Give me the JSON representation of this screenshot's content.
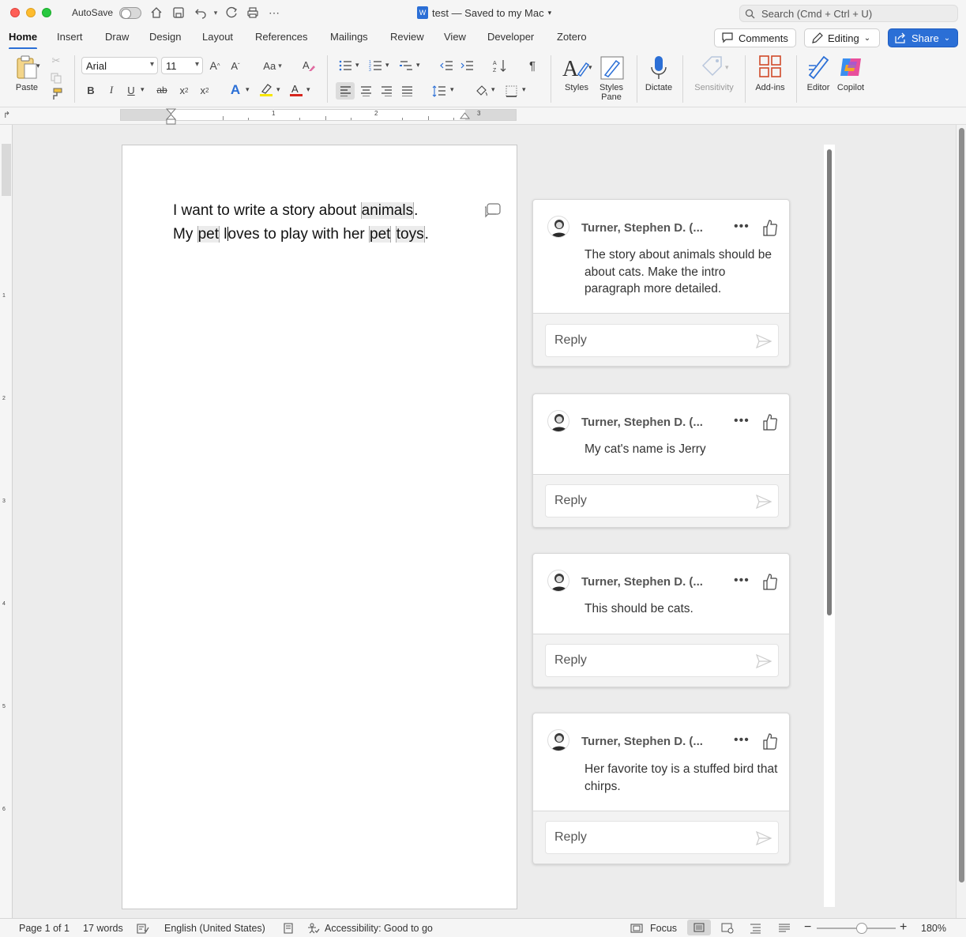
{
  "titlebar": {
    "autosave_label": "AutoSave",
    "doc_title": "test — Saved to my Mac",
    "search_placeholder": "Search (Cmd + Ctrl + U)"
  },
  "tabs": [
    "Home",
    "Insert",
    "Draw",
    "Design",
    "Layout",
    "References",
    "Mailings",
    "Review",
    "View",
    "Developer",
    "Zotero"
  ],
  "tab_actions": {
    "comments": "Comments",
    "editing": "Editing",
    "share": "Share"
  },
  "ribbon": {
    "paste_label": "Paste",
    "font_name": "Arial",
    "font_size": "11",
    "styles_label": "Styles",
    "styles_pane_label": "Styles Pane",
    "dictate_label": "Dictate",
    "sensitivity_label": "Sensitivity",
    "addins_label": "Add-ins",
    "editor_label": "Editor",
    "copilot_label": "Copilot",
    "change_case": "Aa",
    "bold": "B",
    "italic": "I",
    "underline": "U",
    "strike": "ab",
    "subscript": "x",
    "superscript": "x",
    "pilcrow": "¶"
  },
  "ruler": {
    "numbers": [
      "1",
      "2",
      "3"
    ]
  },
  "vruler": {
    "numbers": [
      "1",
      "2",
      "3",
      "4",
      "5",
      "6"
    ]
  },
  "document": {
    "line1": {
      "before": "I want to write a story about ",
      "hl": "animals",
      "after": "."
    },
    "line2": {
      "w1": "My ",
      "hl1": "pet",
      "mid1": " l",
      "mid2": "oves to play with her ",
      "hl2": "pet",
      "sp": " ",
      "hl3": "toys",
      "end": "."
    }
  },
  "comments": [
    {
      "author": "Turner, Stephen D. (...",
      "text": "The story about animals should be about cats. Make the intro paragraph more detailed.",
      "reply_placeholder": "Reply"
    },
    {
      "author": "Turner, Stephen D. (...",
      "text": "My cat's name is Jerry",
      "reply_placeholder": "Reply"
    },
    {
      "author": "Turner, Stephen D. (...",
      "text": "This should be cats.",
      "reply_placeholder": "Reply"
    },
    {
      "author": "Turner, Stephen D. (...",
      "text": "Her favorite toy is a stuffed bird that chirps.",
      "reply_placeholder": "Reply"
    }
  ],
  "statusbar": {
    "page": "Page 1 of 1",
    "words": "17 words",
    "language": "English (United States)",
    "accessibility": "Accessibility: Good to go",
    "focus": "Focus",
    "zoom": "180%"
  },
  "colors": {
    "accent": "#2b6fd6",
    "highlight": "#ececec"
  }
}
